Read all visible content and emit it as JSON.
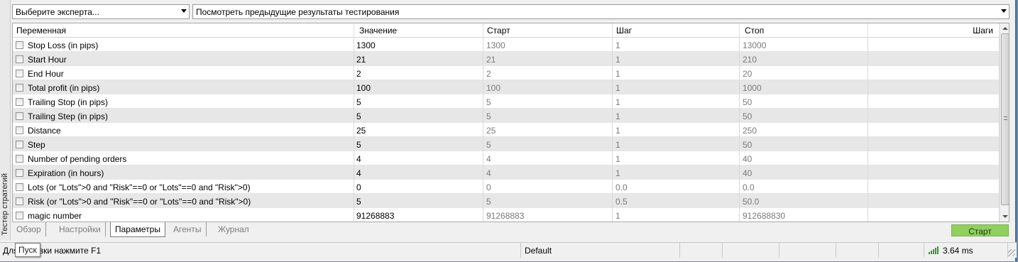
{
  "sidebar": {
    "title": "Тестер стратегий"
  },
  "toolbar": {
    "expert_select": "Выберите эксперта...",
    "results_select": "Посмотреть предыдущие результаты тестирования"
  },
  "grid": {
    "headers": [
      "Переменная",
      "Значение",
      "Старт",
      "Шаг",
      "Стоп",
      "Шаги"
    ],
    "rows": [
      {
        "name": "Stop Loss (in pips)",
        "value": "1300",
        "start": "1300",
        "step": "1",
        "stop": "13000",
        "steps": ""
      },
      {
        "name": "Start Hour",
        "value": "21",
        "start": "21",
        "step": "1",
        "stop": "210",
        "steps": ""
      },
      {
        "name": "End Hour",
        "value": "2",
        "start": "2",
        "step": "1",
        "stop": "20",
        "steps": ""
      },
      {
        "name": "Total profit (in pips)",
        "value": "100",
        "start": "100",
        "step": "1",
        "stop": "1000",
        "steps": ""
      },
      {
        "name": "Trailing Stop (in pips)",
        "value": "5",
        "start": "5",
        "step": "1",
        "stop": "50",
        "steps": ""
      },
      {
        "name": "Trailing Step (in pips)",
        "value": "5",
        "start": "5",
        "step": "1",
        "stop": "50",
        "steps": ""
      },
      {
        "name": "Distance",
        "value": "25",
        "start": "25",
        "step": "1",
        "stop": "250",
        "steps": ""
      },
      {
        "name": "Step",
        "value": "5",
        "start": "5",
        "step": "1",
        "stop": "50",
        "steps": ""
      },
      {
        "name": "Number of pending orders",
        "value": "4",
        "start": "4",
        "step": "1",
        "stop": "40",
        "steps": ""
      },
      {
        "name": "Expiration (in hours)",
        "value": "4",
        "start": "4",
        "step": "1",
        "stop": "40",
        "steps": ""
      },
      {
        "name": "Lots (or \"Lots\">0 and \"Risk\"==0 or \"Lots\"==0 and \"Risk\">0)",
        "value": "0",
        "start": "0",
        "step": "0.0",
        "stop": "0.0",
        "steps": ""
      },
      {
        "name": "Risk (or \"Lots\">0 and \"Risk\"==0 or \"Lots\"==0 and \"Risk\">0)",
        "value": "5",
        "start": "5",
        "step": "0.5",
        "stop": "50.0",
        "steps": ""
      },
      {
        "name": "magic number",
        "value": "91268883",
        "start": "91268883",
        "step": "1",
        "stop": "912688830",
        "steps": ""
      }
    ]
  },
  "tabs": [
    {
      "label": "Обзор",
      "active": false
    },
    {
      "label": "Настройки",
      "active": false
    },
    {
      "label": "Параметры",
      "active": true
    },
    {
      "label": "Агенты",
      "active": false
    },
    {
      "label": "Журнал",
      "active": false
    }
  ],
  "start_button": {
    "label": "Старт",
    "color": "#8fd05f"
  },
  "statusbar": {
    "help_text": "Для справки нажмите F1",
    "profile": "Default",
    "ping": "3.64 ms",
    "tooltip": "Пуск"
  }
}
